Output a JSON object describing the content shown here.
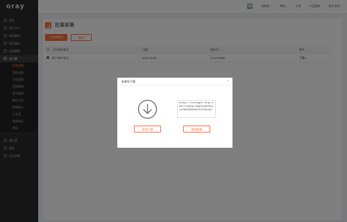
{
  "app": {
    "logo": "oray"
  },
  "top_nav": {
    "items": [
      {
        "label": "控制台",
        "has_chevron": false
      },
      {
        "label": "帮助",
        "has_chevron": true
      },
      {
        "label": "工单",
        "has_chevron": false
      },
      {
        "label": "产品服务",
        "has_chevron": false
      },
      {
        "label": "账号名称",
        "has_chevron": true
      }
    ]
  },
  "sidebar": {
    "items": [
      {
        "label": "首页",
        "icon": "home-icon"
      },
      {
        "label": "用户中心",
        "icon": "user-icon"
      },
      {
        "label": "域名解析",
        "icon": "globe-icon"
      },
      {
        "label": "购买服务",
        "icon": "cart-icon"
      },
      {
        "label": "远程管理",
        "icon": "monitor-icon"
      }
    ],
    "active": {
      "label": "向日葵",
      "icon": "sunflower-icon"
    },
    "sub_items": [
      {
        "label": "批量部署",
        "current": true
      },
      {
        "label": "我的设备",
        "current": false
      },
      {
        "label": "分组管理",
        "current": false
      },
      {
        "label": "权限管理",
        "current": false
      },
      {
        "label": "账号管理",
        "current": false
      },
      {
        "label": "操作日志",
        "current": false
      },
      {
        "label": "数据统计",
        "current": false
      },
      {
        "label": "企业版",
        "current": false
      },
      {
        "label": "服务购买",
        "current": false
      },
      {
        "label": "帮助",
        "current": false
      }
    ],
    "bottom_items": [
      {
        "label": "蒲公英",
        "icon": "network-icon"
      },
      {
        "label": "域名",
        "icon": "domain-icon"
      },
      {
        "label": "企业定制",
        "icon": "building-icon"
      }
    ]
  },
  "page": {
    "title": "批量部署",
    "buttons": {
      "primary": "生成安装包",
      "secondary": "删除"
    },
    "table": {
      "headers": [
        "已生成安装包",
        "日期",
        "版本号",
        "操作"
      ],
      "rows": [
        {
          "name": "客户端安装包",
          "date": "2021-03-25",
          "version": "2.0.0.20860",
          "op": "下载"
        }
      ]
    }
  },
  "modal": {
    "title": "安装包下载",
    "close_symbol": "×",
    "url": "https://sunlogin.oray.com/c/setup/download?key=ec9b4f6b9b4f3f4f5e1a2",
    "download_button": "本地下载",
    "copy_button": "复制链接"
  },
  "colors": {
    "accent": "#ff6a3d",
    "sidebar_bg": "#2b2b2b",
    "checkbox_checked": "#4a7de3"
  }
}
